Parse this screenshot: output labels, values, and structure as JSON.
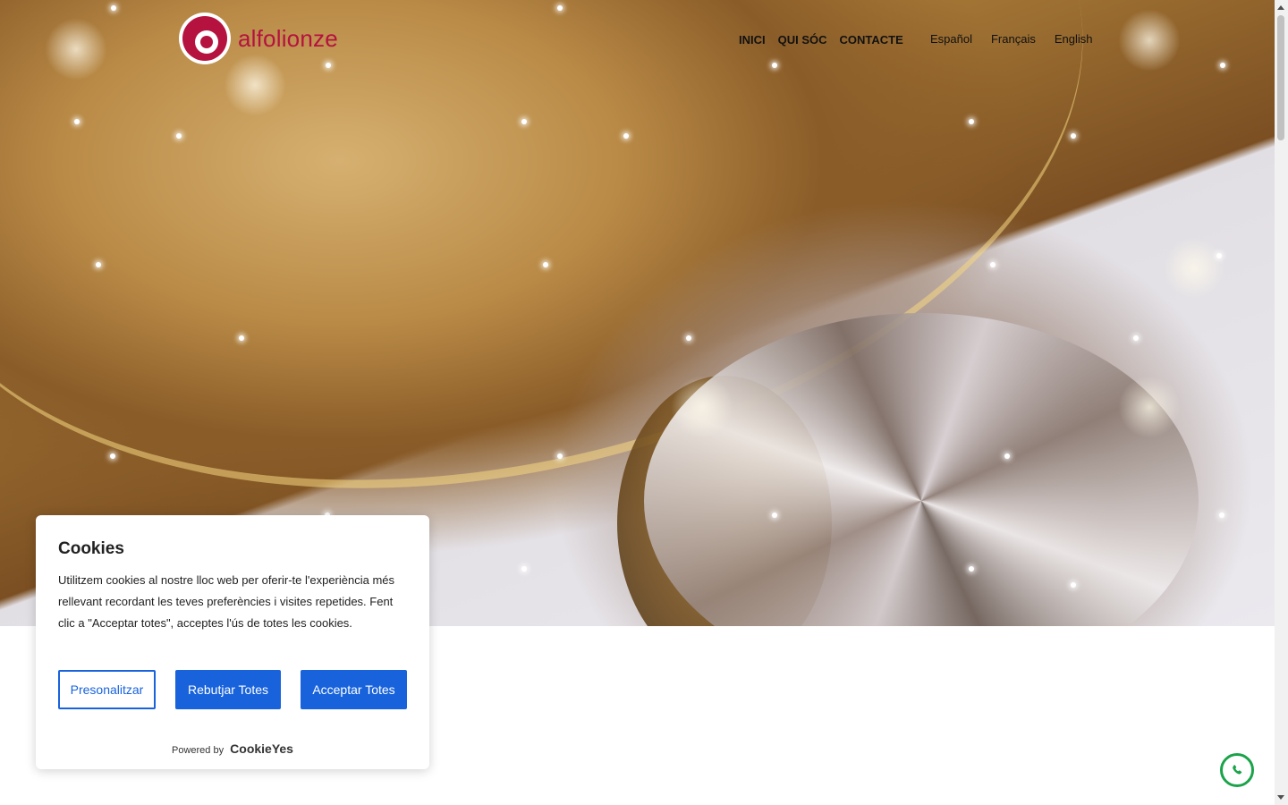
{
  "brand": {
    "name": "alfolionze",
    "color": "#b5123f"
  },
  "nav": {
    "items": [
      {
        "label": "INICI"
      },
      {
        "label": "QUI SÓC"
      },
      {
        "label": "CONTACTE"
      }
    ],
    "languages": [
      {
        "label": "Español"
      },
      {
        "label": "Français"
      },
      {
        "label": "English"
      }
    ]
  },
  "hero": {
    "image": "gold ring with diamond"
  },
  "cookie_banner": {
    "title": "Cookies",
    "text": "Utilitzem cookies al nostre lloc web per oferir-te l'experiència més rellevant recordant les teves preferències i visites repetides. Fent clic a \"Acceptar totes\", acceptes l'ús de totes les cookies.",
    "customize_label": "Presonalitzar",
    "reject_label": "Rebutjar Totes",
    "accept_label": "Acceptar Totes",
    "powered_by": "Powered by",
    "powered_brand": "CookieYes",
    "accent_color": "#1863dc"
  },
  "whatsapp": {
    "icon": "whatsapp-icon",
    "color": "#1ba34a"
  }
}
